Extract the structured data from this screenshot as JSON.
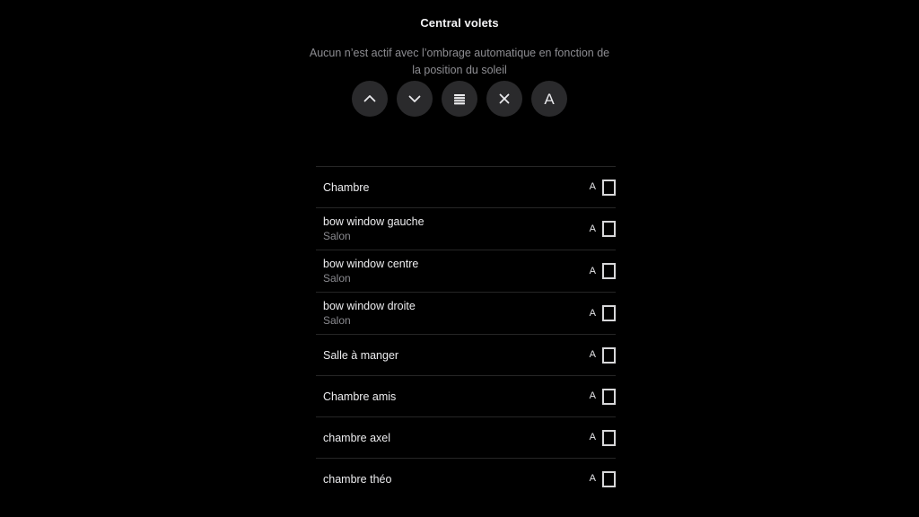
{
  "header": {
    "title": "Central volets",
    "subtitle": "Aucun n’est actif avec l’ombrage automatique en fonction de la position du soleil"
  },
  "controls": [
    {
      "name": "open-up-button",
      "icon": "chevron-up-icon",
      "label": ""
    },
    {
      "name": "close-down-button",
      "icon": "chevron-down-icon",
      "label": ""
    },
    {
      "name": "slats-button",
      "icon": "slats-icon",
      "label": ""
    },
    {
      "name": "stop-button",
      "icon": "close-x-icon",
      "label": ""
    },
    {
      "name": "auto-mode-button",
      "icon": "letter-a-icon",
      "label": "A"
    }
  ],
  "list": {
    "rows": [
      {
        "name": "Chambre",
        "room": "",
        "auto": "A",
        "state": "open"
      },
      {
        "name": "bow window gauche",
        "room": "Salon",
        "auto": "A",
        "state": "open"
      },
      {
        "name": "bow window centre",
        "room": "Salon",
        "auto": "A",
        "state": "open"
      },
      {
        "name": "bow window droite",
        "room": "Salon",
        "auto": "A",
        "state": "open"
      },
      {
        "name": "Salle à manger",
        "room": "",
        "auto": "A",
        "state": "open"
      },
      {
        "name": "Chambre amis",
        "room": "",
        "auto": "A",
        "state": "open"
      },
      {
        "name": "chambre axel",
        "room": "",
        "auto": "A",
        "state": "open"
      },
      {
        "name": "chambre théo",
        "room": "",
        "auto": "A",
        "state": "open"
      }
    ]
  },
  "colors": {
    "background": "#000000",
    "button_bg": "#2a2a2c",
    "primary_text": "#ededef",
    "secondary_text": "#8a8a8f",
    "divider": "#262626",
    "icon_stroke": "#d8d8da"
  }
}
